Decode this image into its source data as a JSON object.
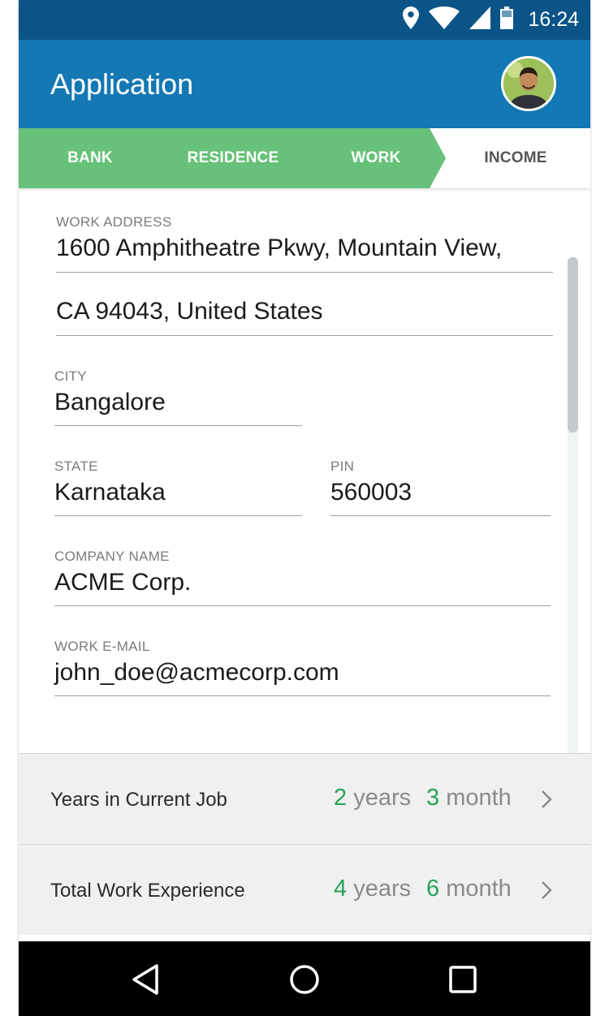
{
  "status_bar": {
    "time": "16:24",
    "icons": [
      "location-pin-icon",
      "wifi-icon",
      "cell-signal-icon",
      "battery-icon"
    ]
  },
  "app_bar": {
    "title": "Application",
    "avatar_icon": "user-avatar"
  },
  "stepper": {
    "steps": [
      {
        "label": "BANK",
        "state": "done"
      },
      {
        "label": "RESIDENCE",
        "state": "done"
      },
      {
        "label": "WORK",
        "state": "current"
      },
      {
        "label": "INCOME",
        "state": "pending"
      }
    ],
    "done_color": "#67c17a"
  },
  "form": {
    "work_address": {
      "label": "WORK ADDRESS",
      "line1": "1600 Amphitheatre Pkwy, Mountain View,",
      "line2": "CA 94043, United States"
    },
    "city": {
      "label": "CITY",
      "value": "Bangalore"
    },
    "state": {
      "label": "STATE",
      "value": "Karnataka"
    },
    "pin": {
      "label": "PIN",
      "value": "560003"
    },
    "company_name": {
      "label": "COMPANY NAME",
      "value": "ACME Corp."
    },
    "work_email": {
      "label": "WORK E-MAIL",
      "value": "john_doe@acmecorp.com"
    }
  },
  "rows": [
    {
      "label": "Years in Current Job",
      "years_num": "2",
      "years_unit": "years",
      "months_num": "3",
      "months_unit": "month"
    },
    {
      "label": "Total Work Experience",
      "years_num": "4",
      "years_unit": "years",
      "months_num": "6",
      "months_unit": "month"
    }
  ],
  "colors": {
    "status_bar": "#0a5487",
    "app_bar": "#1378b4",
    "accent_green": "#27a356"
  },
  "nav_bar": {
    "icons": [
      "back-icon",
      "home-icon",
      "recents-icon"
    ]
  }
}
